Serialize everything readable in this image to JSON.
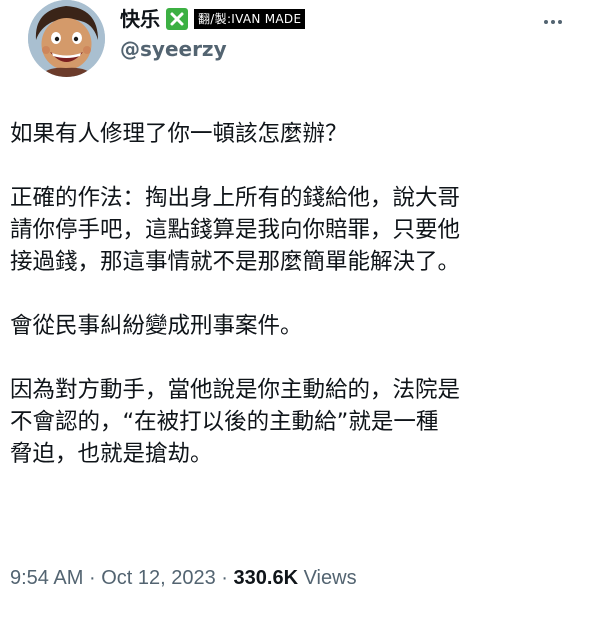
{
  "author": {
    "display_name": "快乐",
    "badge_icon": "green-x-icon",
    "tag_text": "翻/製:IVAN MADE",
    "handle": "@syeerzy"
  },
  "tweet": {
    "paragraphs": [
      "如果有人修理了你一頓該怎麼辦？",
      "正確的作法：掏出身上所有的錢給他，說大哥\n請你停手吧，這點錢算是我向你賠罪，只要他\n接過錢，那這事情就不是那麼簡單能解決了。",
      "會從民事糾紛變成刑事案件。",
      "因為對方動手，當他說是你主動給的，法院是\n不會認的，“在被打以後的主動給”就是一種\n脅迫，也就是搶劫。"
    ]
  },
  "meta": {
    "time": "9:54 AM",
    "separator": "·",
    "date": "Oct 12, 2023",
    "views_count": "330.6K",
    "views_label": "Views"
  },
  "colors": {
    "text": "#0f1419",
    "secondary": "#536471",
    "badge_green": "#3cb043"
  }
}
